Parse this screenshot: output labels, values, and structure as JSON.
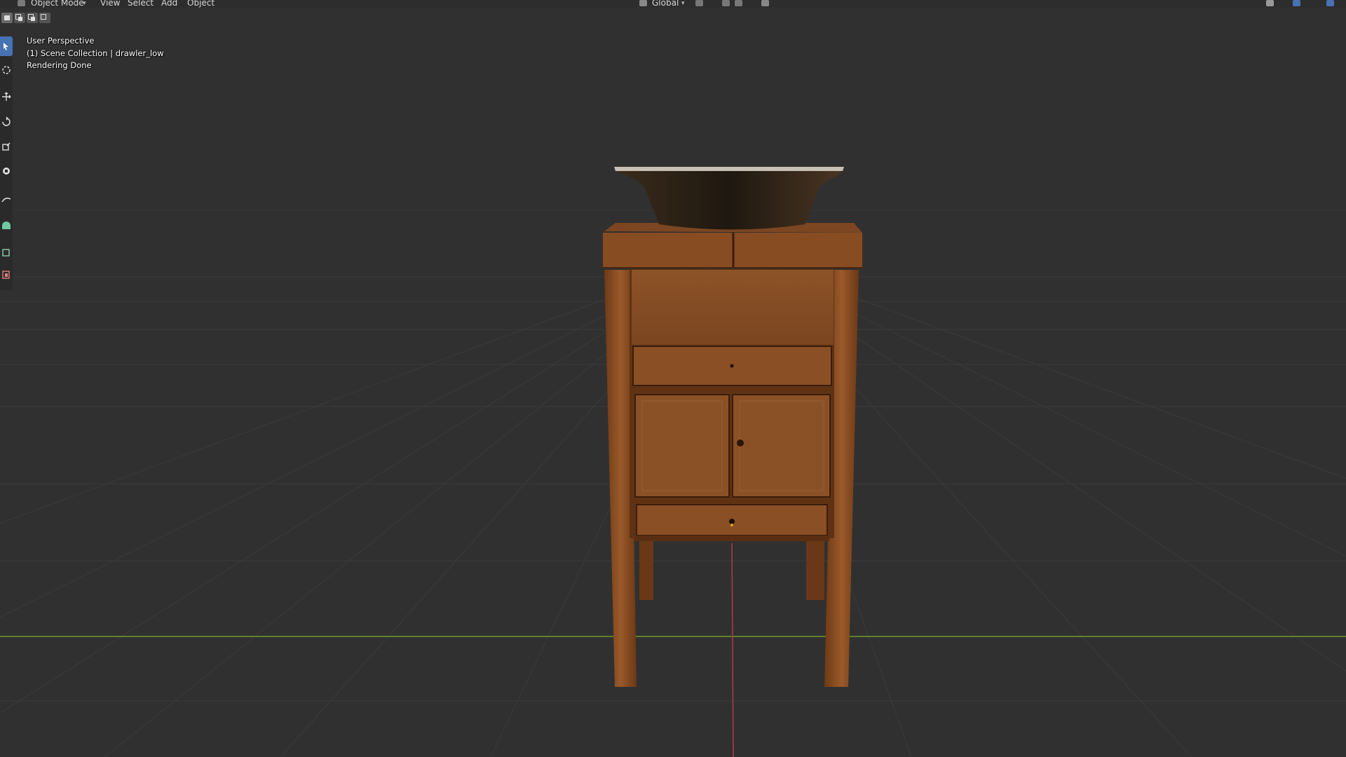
{
  "header": {
    "mode_label": "Object Mode",
    "menus": [
      "View",
      "Select",
      "Add",
      "Object"
    ],
    "orientation_label": "Global"
  },
  "overlay": {
    "view_name": "User Perspective",
    "collection_info": "(1) Scene Collection | drawler_low",
    "status": "Rendering Done"
  },
  "toolbar": {
    "tools": [
      "select-box-icon",
      "cursor-icon",
      "move-icon",
      "rotate-icon",
      "scale-icon",
      "transform-icon",
      "annotate-icon",
      "measure-icon",
      "add-cube-icon",
      "extrude-icon"
    ],
    "active_tool": "select-box-icon"
  },
  "colors": {
    "viewport_bg": "#303030",
    "grid_line": "#3a3a3a",
    "x_axis": "#b03a48",
    "y_axis": "#6c9a2b",
    "active_tool": "#4772b3",
    "wood": "#8a4f24",
    "basin": "#2c2217"
  }
}
